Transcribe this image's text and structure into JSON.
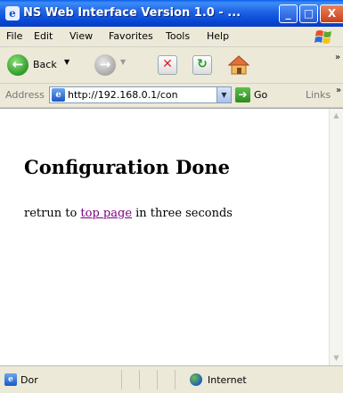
{
  "window": {
    "title": "NS Web Interface Version 1.0 - ...",
    "buttons": {
      "minimize": "_",
      "maximize": "□",
      "close": "X"
    }
  },
  "menu": [
    "File",
    "Edit",
    "View",
    "Favorites",
    "Tools",
    "Help"
  ],
  "toolbar": {
    "back_label": "Back",
    "overflow": "»"
  },
  "address": {
    "label": "Address",
    "url": "http://192.168.0.1/con",
    "go_label": "Go",
    "links_label": "Links",
    "overflow": "»"
  },
  "page": {
    "heading": "Configuration Done",
    "text_before": "retrun to ",
    "link_text": "top page",
    "text_after": " in three seconds"
  },
  "status": {
    "text": "Dor",
    "zone": "Internet"
  },
  "icons": {
    "app": "ie-icon",
    "back": "back-arrow-icon",
    "forward": "forward-arrow-icon",
    "stop": "stop-icon",
    "refresh": "refresh-icon",
    "home": "home-icon",
    "go": "go-arrow-icon",
    "status": "page-icon",
    "zone": "globe-icon"
  }
}
